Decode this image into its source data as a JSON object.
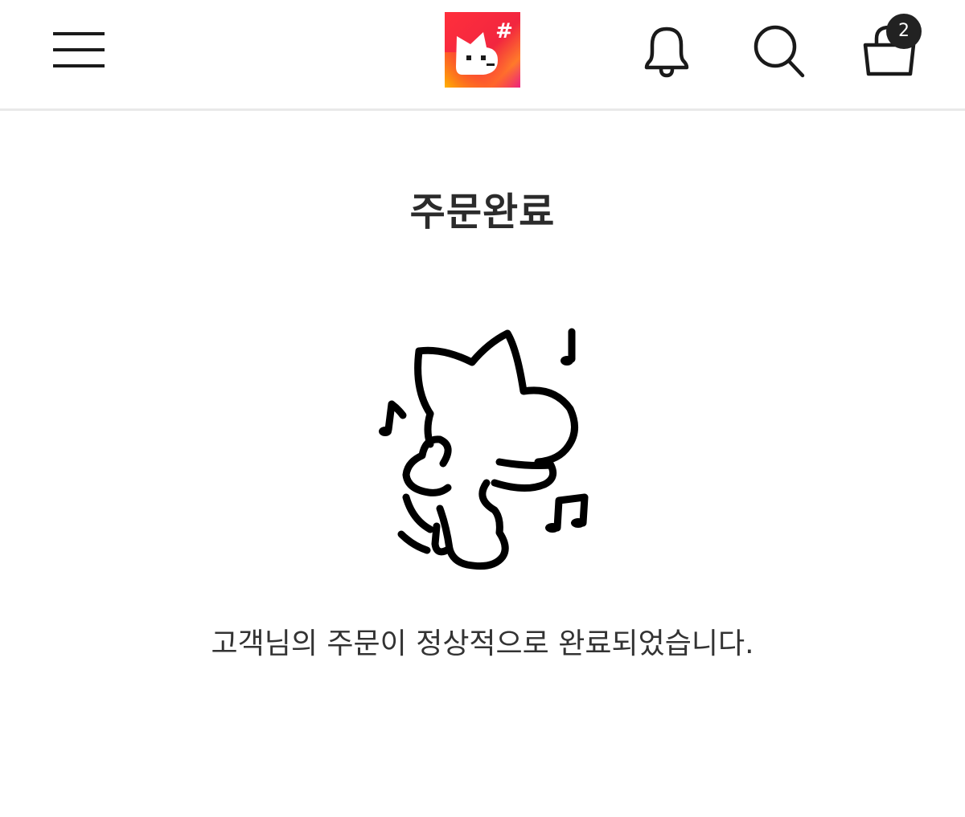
{
  "header": {
    "menu_icon": "hamburger-menu-icon",
    "logo_icon": "cat-hashtag-logo",
    "notification_icon": "bell-icon",
    "search_icon": "search-icon",
    "cart_icon": "shopping-bag-icon",
    "cart_count": "2",
    "logo_colors": [
      "#ff3b3b",
      "#ff8a00",
      "#e8206e"
    ]
  },
  "main": {
    "title": "주문완료",
    "illustration": "dancing-cat-with-music-notes",
    "message": "고객님의 주문이 정상적으로 완료되었습니다."
  }
}
